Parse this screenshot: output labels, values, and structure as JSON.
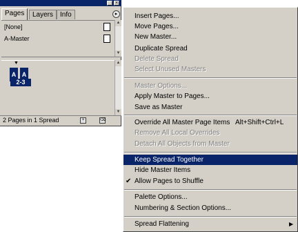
{
  "palette": {
    "tabs": [
      {
        "label": "Pages",
        "active": true
      },
      {
        "label": "Layers",
        "active": false
      },
      {
        "label": "Info",
        "active": false
      }
    ],
    "masters": [
      {
        "label": "[None]"
      },
      {
        "label": "A-Master"
      }
    ],
    "spread": {
      "left_page": "A",
      "right_page": "A",
      "label": "2-3"
    },
    "status": "2 Pages in 1 Spread"
  },
  "menu": {
    "items": [
      {
        "label": "Insert Pages...",
        "disabled": false
      },
      {
        "label": "Move Pages...",
        "disabled": false
      },
      {
        "label": "New Master...",
        "disabled": false
      },
      {
        "label": "Duplicate Spread",
        "disabled": false
      },
      {
        "label": "Delete Spread",
        "disabled": true
      },
      {
        "label": "Select Unused Masters",
        "disabled": true
      },
      {
        "label": "Master Options...",
        "disabled": true
      },
      {
        "label": "Apply Master to Pages...",
        "disabled": false
      },
      {
        "label": "Save as Master",
        "disabled": false
      },
      {
        "label": "Override All Master Page Items",
        "shortcut": "Alt+Shift+Ctrl+L",
        "disabled": false
      },
      {
        "label": "Remove All Local Overrides",
        "disabled": true
      },
      {
        "label": "Detach All Objects from Master",
        "disabled": true
      },
      {
        "label": "Keep Spread Together",
        "highlighted": true
      },
      {
        "label": "Hide Master Items",
        "disabled": false
      },
      {
        "label": "Allow Pages to Shuffle",
        "checked": true
      },
      {
        "label": "Palette Options...",
        "disabled": false
      },
      {
        "label": "Numbering & Section Options...",
        "disabled": false
      },
      {
        "label": "Spread Flattening",
        "submenu": true
      }
    ]
  }
}
